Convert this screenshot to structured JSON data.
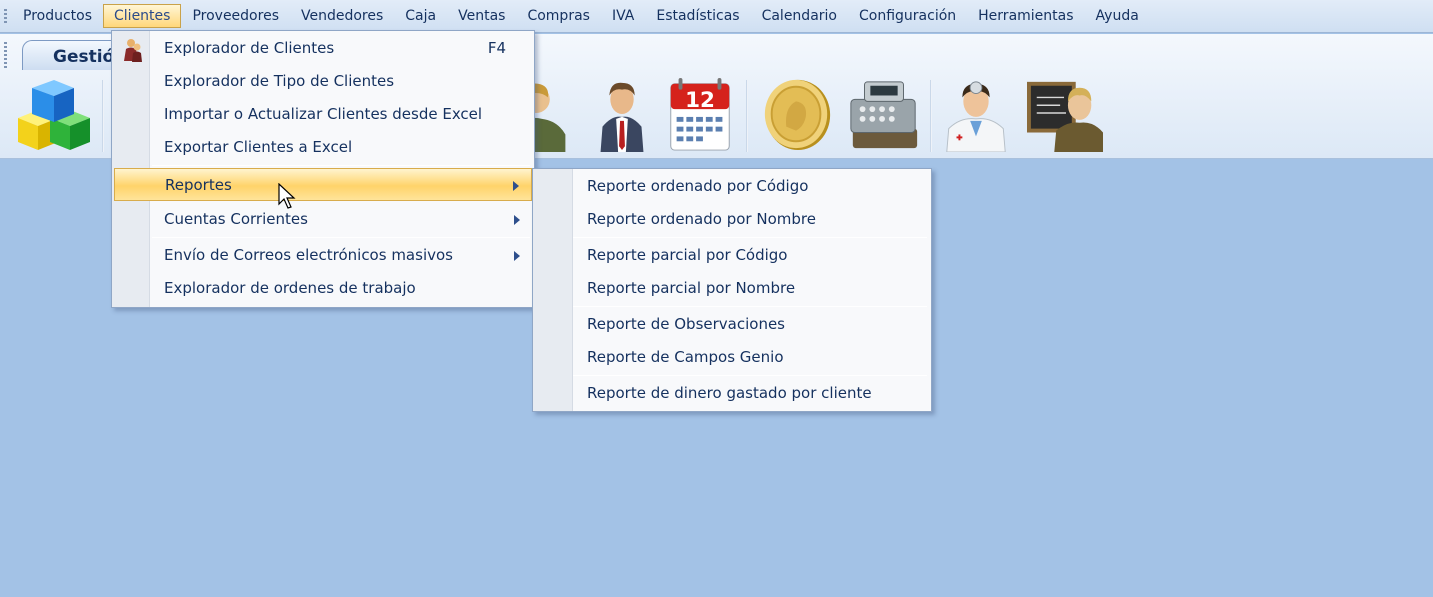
{
  "menubar": {
    "items": [
      "Productos",
      "Clientes",
      "Proveedores",
      "Vendedores",
      "Caja",
      "Ventas",
      "Compras",
      "IVA",
      "Estadísticas",
      "Calendario",
      "Configuración",
      "Herramientas",
      "Ayuda"
    ],
    "active_index": 1
  },
  "ribbon": {
    "tab_label": "Gestión",
    "icons": [
      "cubes-icon",
      "salesman-icon",
      "businessman-icon",
      "calendar-icon",
      "gold-coin-icon",
      "cash-register-icon",
      "doctor-icon",
      "teacher-blackboard-icon"
    ],
    "calendar_day": "12"
  },
  "clientes_menu": {
    "items": [
      {
        "label": "Explorador de Clientes",
        "shortcut": "F4",
        "icon": "clients-icon"
      },
      {
        "label": "Explorador de Tipo de Clientes"
      },
      {
        "label": "Importar o Actualizar Clientes desde Excel"
      },
      {
        "label": "Exportar Clientes a Excel"
      },
      {
        "label": "Reportes",
        "submenu": true,
        "highlighted": true
      },
      {
        "label": "Cuentas Corrientes",
        "submenu": true
      },
      {
        "label": "Envío de Correos electrónicos masivos",
        "submenu": true
      },
      {
        "label": "Explorador de ordenes de trabajo"
      }
    ]
  },
  "reportes_submenu": {
    "items": [
      "Reporte ordenado por Código",
      "Reporte ordenado por Nombre",
      "Reporte parcial por Código",
      "Reporte parcial por Nombre",
      "Reporte de Observaciones",
      "Reporte de Campos Genio",
      "Reporte de dinero gastado por cliente"
    ]
  },
  "colors": {
    "background": "#a3c2e6",
    "menu_text": "#15315f",
    "highlight": "#ffd36a"
  }
}
